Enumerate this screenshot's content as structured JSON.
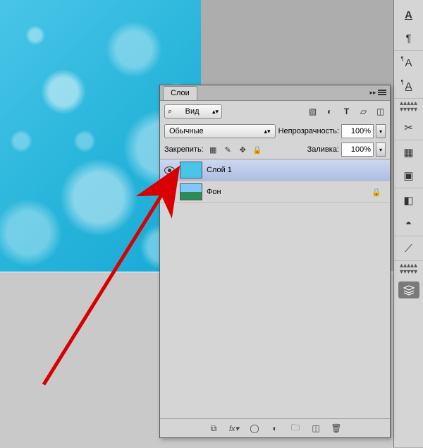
{
  "panel": {
    "title": "Слои",
    "kind_label": "Вид",
    "kind_prefix": "⌕",
    "blend_mode": "Обычные",
    "opacity_label": "Непрозрачность:",
    "opacity_value": "100%",
    "lock_label": "Закрепить:",
    "fill_label": "Заливка:",
    "fill_value": "100%"
  },
  "layers": [
    {
      "name": "Слой 1",
      "visible": true,
      "selected": true,
      "locked": false,
      "thumb": "drops"
    },
    {
      "name": "Фон",
      "visible": true,
      "selected": false,
      "locked": true,
      "thumb": "bg"
    }
  ],
  "filter_icons": [
    "image-icon",
    "adjust-icon",
    "type-icon",
    "shape-icon",
    "smart-icon"
  ],
  "lock_icons": [
    "transparency-lock-icon",
    "brush-lock-icon",
    "move-lock-icon",
    "all-lock-icon"
  ],
  "footer_icons": [
    "link-icon",
    "fx-icon",
    "mask-icon",
    "adjustment-icon",
    "group-icon",
    "new-icon",
    "trash-icon"
  ],
  "right_tools": {
    "group1": [
      "char-a-icon",
      "paragraph-icon"
    ],
    "group2": [
      "char-a2-icon",
      "para-a-icon"
    ],
    "group3": [
      "crossed-tools-icon"
    ],
    "group4": [
      "swatches-icon",
      "frame-icon"
    ],
    "group5": [
      "cube-icon",
      "sphere-icon"
    ],
    "group6": [
      "path-icon"
    ],
    "group7": [
      "layers-icon"
    ]
  }
}
